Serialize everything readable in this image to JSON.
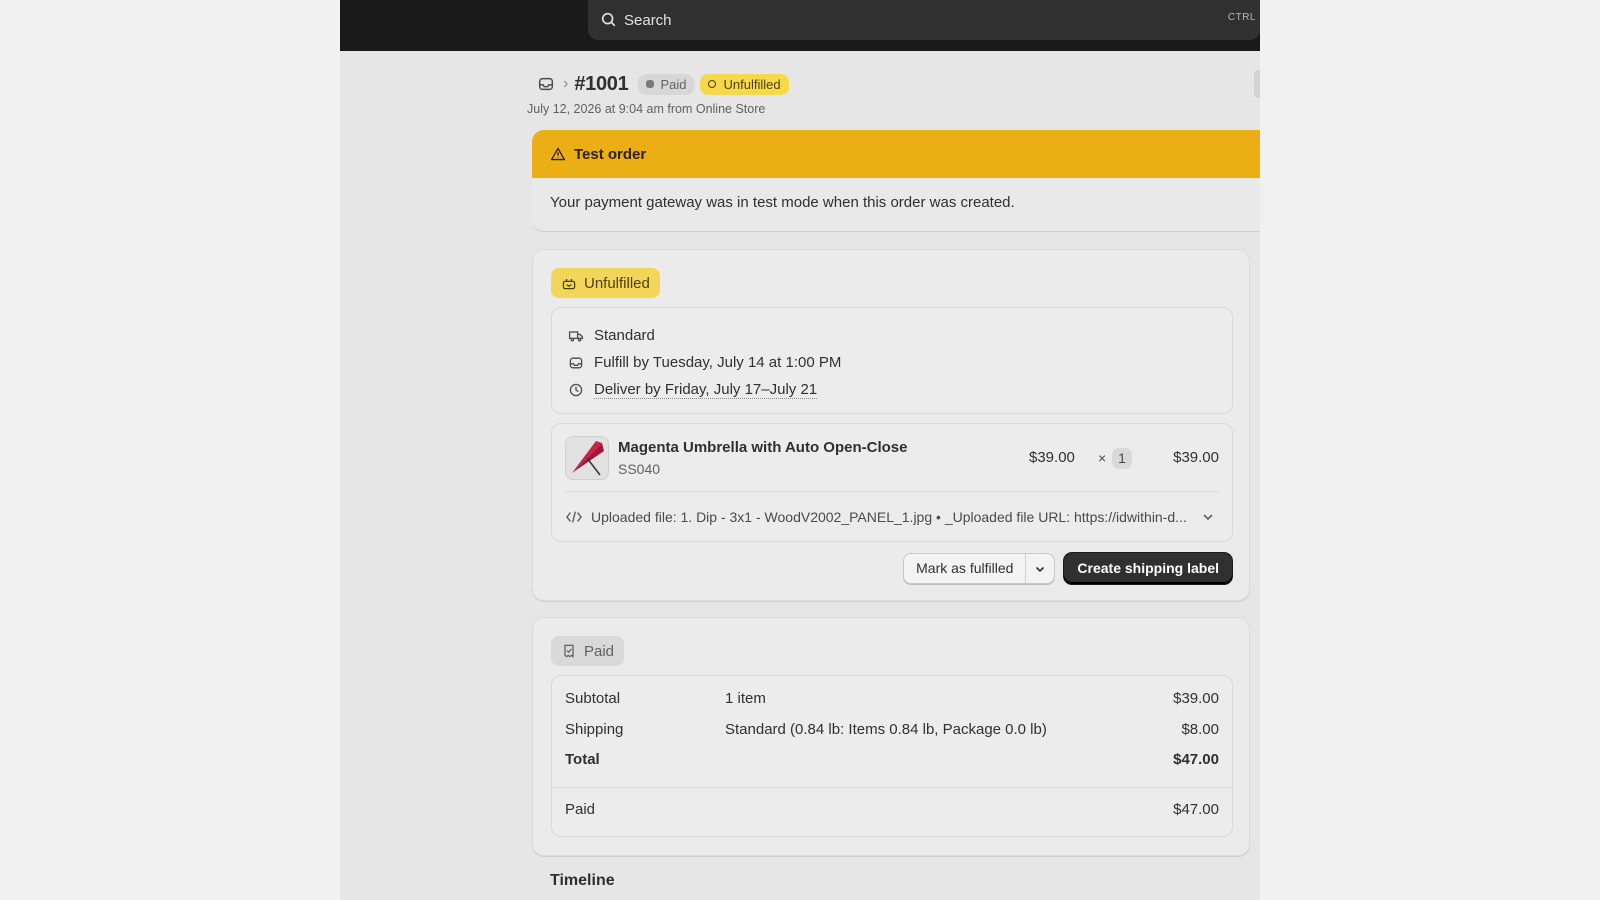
{
  "search": {
    "label": "Search",
    "shortcut": "CTRL"
  },
  "order": {
    "number": "#1001",
    "payment_badge": "Paid",
    "fulfillment_badge": "Unfulfilled",
    "subtitle": "July 12, 2026 at 9:04 am from Online Store"
  },
  "banner": {
    "title": "Test order",
    "message": "Your payment gateway was in test mode when this order was created.",
    "color": "#ebae14"
  },
  "fulfillment": {
    "status_label": "Unfulfilled",
    "method": "Standard",
    "fulfill_by": "Fulfill by Tuesday, July 14 at 1:00 PM",
    "deliver_by": "Deliver by Friday, July 17–July 21",
    "line_item": {
      "title": "Magenta Umbrella with Auto Open-Close",
      "sku": "SS040",
      "unit_price": "$39.00",
      "times": "×",
      "quantity": "1",
      "total": "$39.00",
      "property": "Uploaded file: 1. Dip - 3x1 - WoodV2002_PANEL_1.jpg • _Uploaded file URL: https://idwithin-d..."
    },
    "mark_fulfilled_label": "Mark as fulfilled",
    "create_label_label": "Create shipping label"
  },
  "payment": {
    "status_label": "Paid",
    "subtotal": {
      "label": "Subtotal",
      "detail": "1 item",
      "amount": "$39.00"
    },
    "shipping": {
      "label": "Shipping",
      "detail": "Standard (0.84 lb: Items 0.84 lb, Package 0.0 lb)",
      "amount": "$8.00"
    },
    "total": {
      "label": "Total",
      "amount": "$47.00"
    },
    "paid": {
      "label": "Paid",
      "amount": "$47.00"
    }
  },
  "timeline": {
    "title": "Timeline"
  },
  "colors": {
    "accent_dark": "#303030",
    "unfulfilled_badge": "#f5d94a",
    "topbar": "#1a1a1a"
  }
}
